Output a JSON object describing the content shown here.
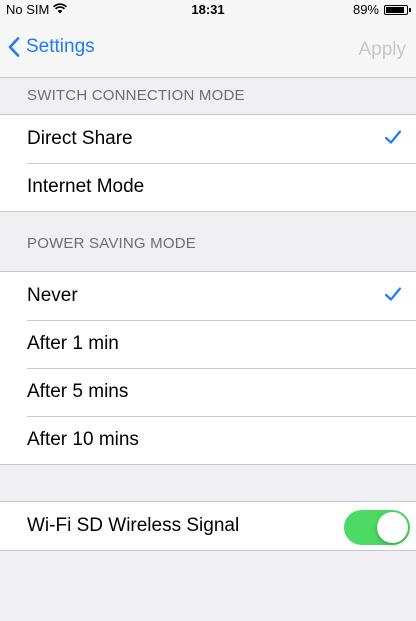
{
  "status_bar": {
    "carrier": "No SIM",
    "time": "18:31",
    "battery_pct": "89%",
    "battery_level": 0.89
  },
  "nav": {
    "back_label": "Settings",
    "apply_label": "Apply"
  },
  "sections": [
    {
      "header": "SWITCH CONNECTION MODE",
      "items": [
        {
          "label": "Direct Share",
          "checked": true
        },
        {
          "label": "Internet Mode",
          "checked": false
        }
      ]
    },
    {
      "header": "POWER SAVING MODE",
      "items": [
        {
          "label": "Never",
          "checked": true
        },
        {
          "label": "After 1 min",
          "checked": false
        },
        {
          "label": "After 5 mins",
          "checked": false
        },
        {
          "label": "After 10 mins",
          "checked": false
        }
      ]
    }
  ],
  "wifi_signal": {
    "label": "Wi-Fi SD Wireless Signal",
    "enabled": true
  },
  "colors": {
    "accent": "#1f7cf6",
    "toggle_on": "#4cd964",
    "background": "#efeff4",
    "disabled": "#c7c7cc"
  }
}
